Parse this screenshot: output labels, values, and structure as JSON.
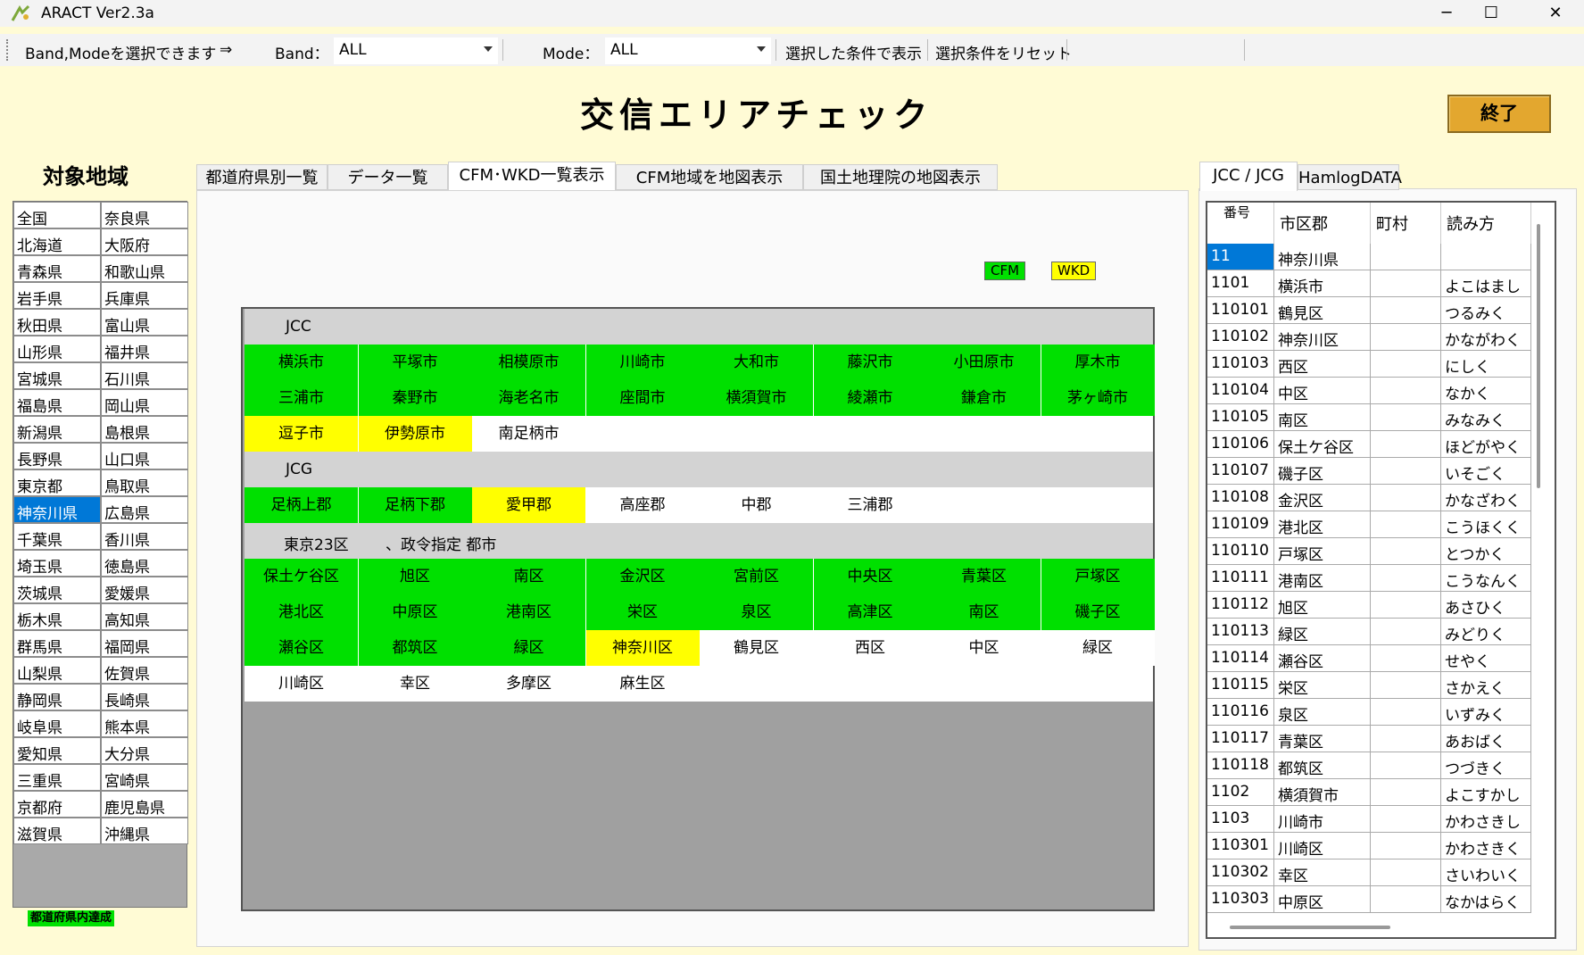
{
  "window": {
    "title": "ARACT Ver2.3a",
    "min": "─",
    "max": "☐",
    "close": "✕"
  },
  "toolbar": {
    "hint": "Band,Modeを選択できます",
    "arrow": "⇒",
    "band_label": "Band：",
    "band_value": "ALL",
    "mode_label": "Mode：",
    "mode_value": "ALL",
    "show_btn": "選択した条件で表示",
    "reset_btn": "選択条件をリセット"
  },
  "main_title": "交信エリアチェック",
  "exit_label": "終了",
  "region_label": "対象地域",
  "prefectures": [
    [
      "全国",
      "奈良県"
    ],
    [
      "北海道",
      "大阪府"
    ],
    [
      "青森県",
      "和歌山県"
    ],
    [
      "岩手県",
      "兵庫県"
    ],
    [
      "秋田県",
      "富山県"
    ],
    [
      "山形県",
      "福井県"
    ],
    [
      "宮城県",
      "石川県"
    ],
    [
      "福島県",
      "岡山県"
    ],
    [
      "新潟県",
      "島根県"
    ],
    [
      "長野県",
      "山口県"
    ],
    [
      "東京都",
      "鳥取県"
    ],
    [
      "神奈川県",
      "広島県"
    ],
    [
      "千葉県",
      "香川県"
    ],
    [
      "埼玉県",
      "徳島県"
    ],
    [
      "茨城県",
      "愛媛県"
    ],
    [
      "栃木県",
      "高知県"
    ],
    [
      "群馬県",
      "福岡県"
    ],
    [
      "山梨県",
      "佐賀県"
    ],
    [
      "静岡県",
      "長崎県"
    ],
    [
      "岐阜県",
      "熊本県"
    ],
    [
      "愛知県",
      "大分県"
    ],
    [
      "三重県",
      "宮崎県"
    ],
    [
      "京都府",
      "鹿児島県"
    ],
    [
      "滋賀県",
      "沖縄県"
    ]
  ],
  "selected_pref": "神奈川県",
  "legend_done": "都道府県内達成",
  "tabs_left": [
    "都道府県別一覧",
    "データ一覧",
    "CFM･WKD一覧表示",
    "CFM地域を地図表示",
    "国土地理院の地図表示"
  ],
  "legend_cfm": "CFM",
  "legend_wkd": "WKD",
  "area": {
    "jcc_header": "JCC",
    "jcc_rows": [
      [
        [
          "横浜市",
          "g"
        ],
        [
          "平塚市",
          "g"
        ],
        [
          "相模原市",
          "g"
        ],
        [
          "川崎市",
          "g"
        ],
        [
          "大和市",
          "g"
        ],
        [
          "藤沢市",
          "g"
        ],
        [
          "小田原市",
          "g"
        ],
        [
          "厚木市",
          "g"
        ]
      ],
      [
        [
          "三浦市",
          "g"
        ],
        [
          "秦野市",
          "g"
        ],
        [
          "海老名市",
          "g"
        ],
        [
          "座間市",
          "g"
        ],
        [
          "横須賀市",
          "g"
        ],
        [
          "綾瀬市",
          "g"
        ],
        [
          "鎌倉市",
          "g"
        ],
        [
          "茅ヶ崎市",
          "g"
        ]
      ],
      [
        [
          "逗子市",
          "y"
        ],
        [
          "伊勢原市",
          "y"
        ],
        [
          "南足柄市",
          "w"
        ]
      ]
    ],
    "jcg_header": "JCG",
    "jcg_rows": [
      [
        [
          "足柄上郡",
          "g"
        ],
        [
          "足柄下郡",
          "g"
        ],
        [
          "愛甲郡",
          "y"
        ],
        [
          "高座郡",
          "w"
        ],
        [
          "中郡",
          "w"
        ],
        [
          "三浦郡",
          "w"
        ]
      ]
    ],
    "ward_header_a": "東京23区",
    "ward_header_b": "、政令指定 都市",
    "ward_rows": [
      [
        [
          "保土ケ谷区",
          "g"
        ],
        [
          "旭区",
          "g"
        ],
        [
          "南区",
          "g"
        ],
        [
          "金沢区",
          "g"
        ],
        [
          "宮前区",
          "g"
        ],
        [
          "中央区",
          "g"
        ],
        [
          "青葉区",
          "g"
        ],
        [
          "戸塚区",
          "g"
        ]
      ],
      [
        [
          "港北区",
          "g"
        ],
        [
          "中原区",
          "g"
        ],
        [
          "港南区",
          "g"
        ],
        [
          "栄区",
          "g"
        ],
        [
          "泉区",
          "g"
        ],
        [
          "高津区",
          "g"
        ],
        [
          "南区",
          "g"
        ],
        [
          "磯子区",
          "g"
        ]
      ],
      [
        [
          "瀬谷区",
          "g"
        ],
        [
          "都筑区",
          "g"
        ],
        [
          "緑区",
          "g"
        ],
        [
          "神奈川区",
          "y"
        ],
        [
          "鶴見区",
          "w"
        ],
        [
          "西区",
          "w"
        ],
        [
          "中区",
          "w"
        ],
        [
          "緑区",
          "w"
        ]
      ],
      [
        [
          "川崎区",
          "w"
        ],
        [
          "幸区",
          "w"
        ],
        [
          "多摩区",
          "w"
        ],
        [
          "麻生区",
          "w"
        ]
      ]
    ]
  },
  "tabs_right": [
    "JCC / JCG",
    "HamlogDATA"
  ],
  "rtable": {
    "headers": [
      "番号",
      "市区郡",
      "町村",
      "読み方"
    ],
    "rows": [
      [
        "11",
        "神奈川県",
        "",
        ""
      ],
      [
        "1101",
        "横浜市",
        "",
        "よこはまし"
      ],
      [
        "110101",
        "鶴見区",
        "",
        "つるみく"
      ],
      [
        "110102",
        "神奈川区",
        "",
        "かながわく"
      ],
      [
        "110103",
        "西区",
        "",
        "にしく"
      ],
      [
        "110104",
        "中区",
        "",
        "なかく"
      ],
      [
        "110105",
        "南区",
        "",
        "みなみく"
      ],
      [
        "110106",
        "保土ケ谷区",
        "",
        "ほどがやく"
      ],
      [
        "110107",
        "磯子区",
        "",
        "いそごく"
      ],
      [
        "110108",
        "金沢区",
        "",
        "かなざわく"
      ],
      [
        "110109",
        "港北区",
        "",
        "こうほくく"
      ],
      [
        "110110",
        "戸塚区",
        "",
        "とつかく"
      ],
      [
        "110111",
        "港南区",
        "",
        "こうなんく"
      ],
      [
        "110112",
        "旭区",
        "",
        "あさひく"
      ],
      [
        "110113",
        "緑区",
        "",
        "みどりく"
      ],
      [
        "110114",
        "瀬谷区",
        "",
        "せやく"
      ],
      [
        "110115",
        "栄区",
        "",
        "さかえく"
      ],
      [
        "110116",
        "泉区",
        "",
        "いずみく"
      ],
      [
        "110117",
        "青葉区",
        "",
        "あおばく"
      ],
      [
        "110118",
        "都筑区",
        "",
        "つづきく"
      ],
      [
        "1102",
        "横須賀市",
        "",
        "よこすかし"
      ],
      [
        "1103",
        "川崎市",
        "",
        "かわさきし"
      ],
      [
        "110301",
        "川崎区",
        "",
        "かわさきく"
      ],
      [
        "110302",
        "幸区",
        "",
        "さいわいく"
      ],
      [
        "110303",
        "中原区",
        "",
        "なかはらく"
      ]
    ]
  },
  "colors": {
    "cfm": "#00e000",
    "wkd": "#ffff00",
    "selection": "#0078d7",
    "exit": "#e3a72f"
  }
}
